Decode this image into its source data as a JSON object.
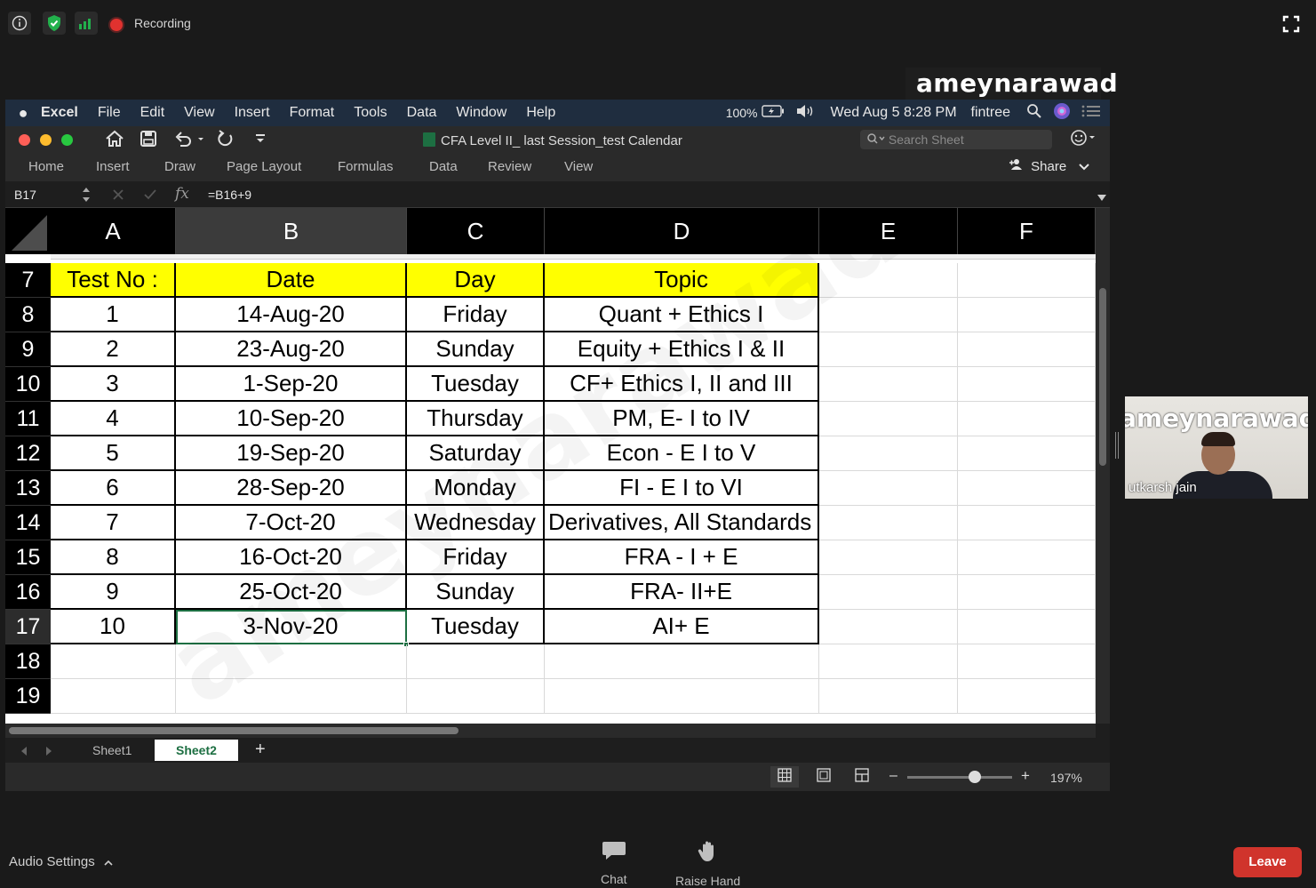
{
  "zoom": {
    "recording_label": "Recording",
    "name_tag": "ameynarawad",
    "audio_settings_label": "Audio Settings",
    "chat_label": "Chat",
    "raise_hand_label": "Raise Hand",
    "leave_label": "Leave",
    "participant": {
      "overlay_text": "ameynarawad",
      "name": "utkarsh jain"
    }
  },
  "mac_menubar": {
    "app": "Excel",
    "menus": [
      "File",
      "Edit",
      "View",
      "Insert",
      "Format",
      "Tools",
      "Data",
      "Window",
      "Help"
    ],
    "battery": "100%",
    "datetime": "Wed Aug 5  8:28 PM",
    "user": "fintree"
  },
  "excel": {
    "doc_title": "CFA Level II_ last Session_test Calendar",
    "search_placeholder": "Search Sheet",
    "ribbon_tabs": [
      "Home",
      "Insert",
      "Draw",
      "Page Layout",
      "Formulas",
      "Data",
      "Review",
      "View"
    ],
    "share_label": "Share",
    "name_box": "B17",
    "fx_label": "fx",
    "formula": "=B16+9",
    "columns": [
      "A",
      "B",
      "C",
      "D",
      "E",
      "F"
    ],
    "selected_column": "B",
    "row_numbers": [
      "7",
      "8",
      "9",
      "10",
      "11",
      "12",
      "13",
      "14",
      "15",
      "16",
      "17",
      "18",
      "19"
    ],
    "selected_row": "17",
    "header_row": [
      "Test No :",
      "Date",
      "Day",
      "Topic"
    ],
    "rows": [
      [
        "1",
        "14-Aug-20",
        "Friday",
        "Quant + Ethics I"
      ],
      [
        "2",
        "23-Aug-20",
        "Sunday",
        "Equity + Ethics I & II"
      ],
      [
        "3",
        "1-Sep-20",
        "Tuesday",
        "CF+ Ethics I, II and III"
      ],
      [
        "4",
        "10-Sep-20",
        "Thursday",
        "PM, E- I to IV"
      ],
      [
        "5",
        "19-Sep-20",
        "Saturday",
        "Econ - E I to V"
      ],
      [
        "6",
        "28-Sep-20",
        "Monday",
        "FI - E I to VI"
      ],
      [
        "7",
        "7-Oct-20",
        "Wednesday",
        "Derivatives, All Standards"
      ],
      [
        "8",
        "16-Oct-20",
        "Friday",
        "FRA - I + E"
      ],
      [
        "9",
        "25-Oct-20",
        "Sunday",
        "FRA- II+E"
      ],
      [
        "10",
        "3-Nov-20",
        "Tuesday",
        "AI+ E"
      ]
    ],
    "sheets": [
      "Sheet1",
      "Sheet2"
    ],
    "active_sheet": "Sheet2",
    "add_sheet": "+",
    "zoom_level": "197%",
    "zoom_minus": "–",
    "zoom_plus": "+"
  },
  "watermark_text": "ameynarawad",
  "colors": {
    "header_fill": "#ffff00",
    "leave_button": "#d0342c",
    "excel_green": "#1d6f42"
  }
}
